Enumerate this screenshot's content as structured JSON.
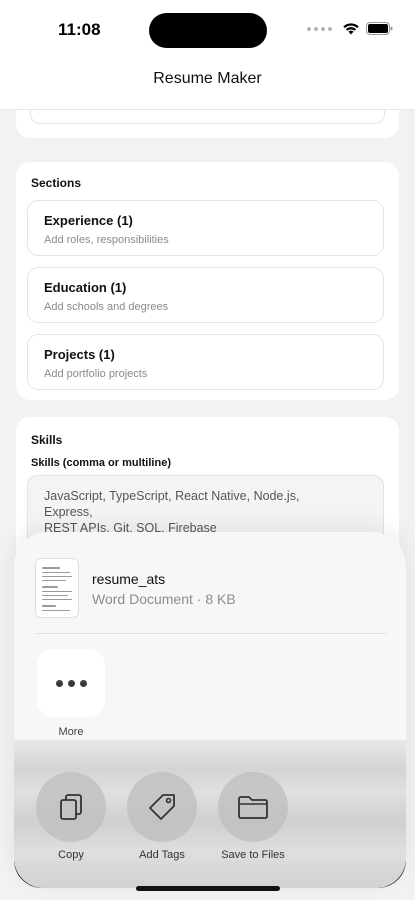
{
  "status_bar": {
    "time": "11:08"
  },
  "nav": {
    "title": "Resume Maker"
  },
  "sections_card": {
    "title": "Sections",
    "items": [
      {
        "label": "Experience (1)",
        "description": "Add roles, responsibilities"
      },
      {
        "label": "Education (1)",
        "description": "Add schools and degrees"
      },
      {
        "label": "Projects (1)",
        "description": "Add portfolio projects"
      }
    ]
  },
  "skills_card": {
    "title": "Skills",
    "field_label": "Skills (comma or multiline)",
    "value": "JavaScript, TypeScript, React Native, Node.js,\nExpress,\nREST APIs, Git, SQL, Firebase"
  },
  "share_sheet": {
    "file_name": "resume_ats",
    "file_meta": "Word Document · 8 KB",
    "more_label": "More",
    "actions": [
      {
        "label": "Copy",
        "icon": "copy-icon"
      },
      {
        "label": "Add Tags",
        "icon": "tag-icon"
      },
      {
        "label": "Save to Files",
        "icon": "folder-icon"
      }
    ]
  }
}
